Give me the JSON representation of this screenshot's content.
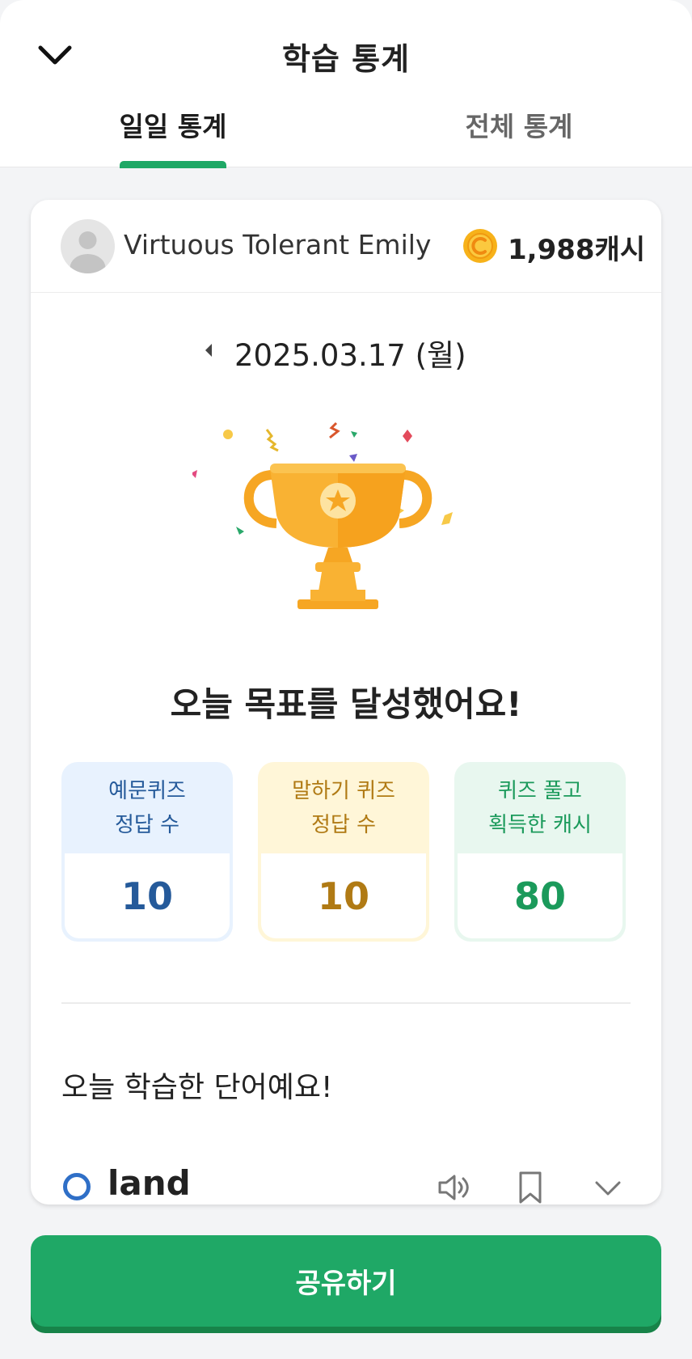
{
  "header": {
    "title": "학습 통계",
    "tabs": [
      {
        "label": "일일 통계",
        "active": true
      },
      {
        "label": "전체 통계",
        "active": false
      }
    ]
  },
  "user": {
    "name": "Virtuous Tolerant Emily",
    "cash": "1,988캐시"
  },
  "date": "2025.03.17 (월)",
  "headline": "오늘 목표를 달성했어요!",
  "stats": [
    {
      "label_line1": "예문퀴즈",
      "label_line2": "정답 수",
      "value": "10",
      "color": "#255a9a"
    },
    {
      "label_line1": "말하기 퀴즈",
      "label_line2": "정답 수",
      "value": "10",
      "color": "#b07a14"
    },
    {
      "label_line1": "퀴즈 풀고",
      "label_line2": "획득한 캐시",
      "value": "80",
      "color": "#1b9a5b"
    }
  ],
  "words_section": {
    "title": "오늘 학습한 단어예요!",
    "words": [
      {
        "word": "land",
        "icons": [
          "speaker-icon",
          "bookmark-icon",
          "chevron-down-icon"
        ]
      }
    ]
  },
  "share_button": "공유하기",
  "colors": {
    "accent": "#1fa866",
    "background": "#f3f4f6"
  }
}
